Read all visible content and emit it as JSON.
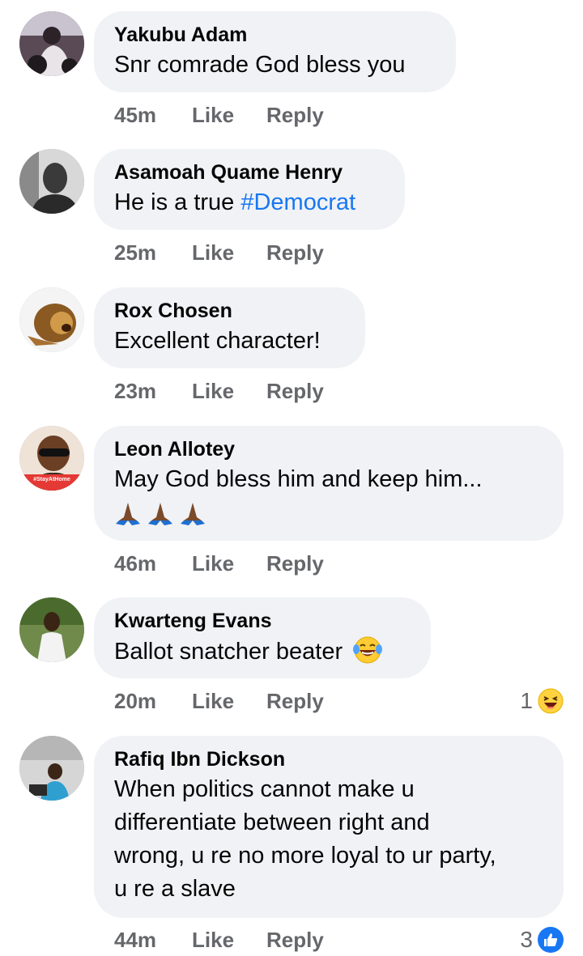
{
  "comments": [
    {
      "name": "Yakubu Adam",
      "text": "Snr comrade God bless you",
      "time": "45m",
      "like": "Like",
      "reply": "Reply",
      "avatar": "person-on-motorbike"
    },
    {
      "name": "Asamoah Quame Henry",
      "text": "He is a true ",
      "hashtag": "#Democrat",
      "time": "25m",
      "like": "Like",
      "reply": "Reply",
      "avatar": "man-black-and-white"
    },
    {
      "name": "Rox Chosen",
      "text": "Excellent character!",
      "time": "23m",
      "like": "Like",
      "reply": "Reply",
      "avatar": "roaring-lion"
    },
    {
      "name": "Leon Allotey",
      "text": "May God bless him and keep him...",
      "time": "46m",
      "like": "Like",
      "reply": "Reply",
      "avatar": "man-with-sunglasses",
      "avatar_badge": "#StayAtHome"
    },
    {
      "name": "Kwarteng Evans",
      "text": "Ballot snatcher beater",
      "time": "20m",
      "like": "Like",
      "reply": "Reply",
      "avatar": "man-outdoors",
      "reaction_count": "1",
      "reaction_type": "haha"
    },
    {
      "name": "Rafiq Ibn Dickson",
      "text_lines": [
        "When politics cannot make u",
        "differentiate between right and",
        "wrong, u re no more loyal to ur party,",
        "u re a slave"
      ],
      "time": "44m",
      "like": "Like",
      "reply": "Reply",
      "avatar": "man-at-desk",
      "reaction_count": "3",
      "reaction_type": "like"
    }
  ],
  "colors": {
    "bubble": "#f0f2f5",
    "hashtag": "#1877f2",
    "meta": "#65676b",
    "text": "#050505"
  }
}
